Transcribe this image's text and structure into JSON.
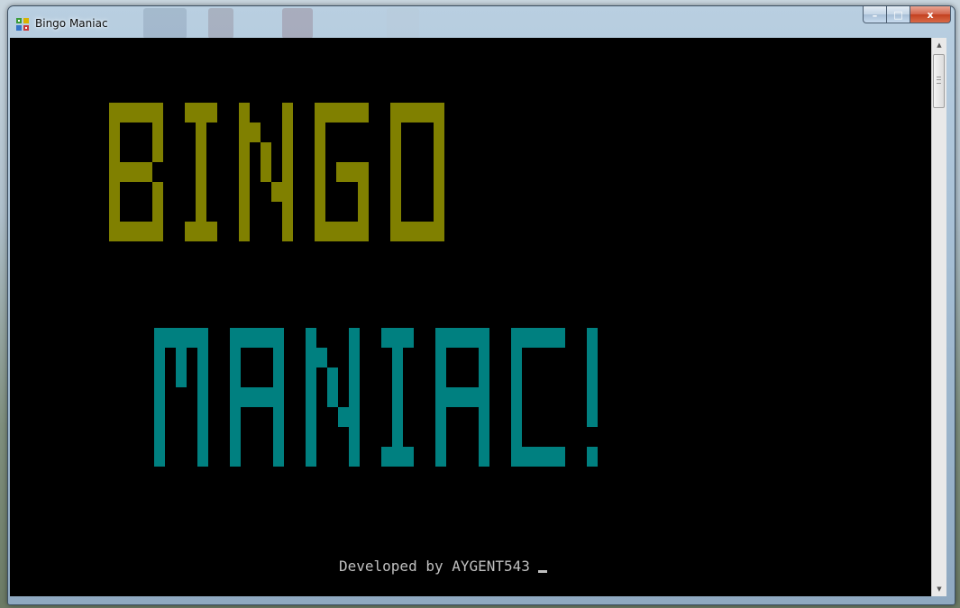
{
  "window": {
    "title": "Bingo Maniac",
    "icon": "bingo-app-icon",
    "controls": {
      "minimize_icon": "minimize-icon",
      "maximize_icon": "maximize-icon",
      "close_icon": "close-icon",
      "minimize_glyph": "–",
      "maximize_glyph": "□",
      "close_glyph": "x"
    }
  },
  "console": {
    "background": "#000000",
    "title_line_1": {
      "text": "BINGO",
      "color": "#808000"
    },
    "title_line_2": {
      "text": "MANIAC!",
      "color": "#008080"
    },
    "credit": {
      "text": "Developed by AYGENT543",
      "color": "#c0c0c0"
    },
    "cursor": "cursor-underscore"
  },
  "scrollbar": {
    "up_icon": "scroll-up-arrow-icon",
    "down_icon": "scroll-down-arrow-icon",
    "up_glyph": "▲",
    "down_glyph": "▼"
  }
}
